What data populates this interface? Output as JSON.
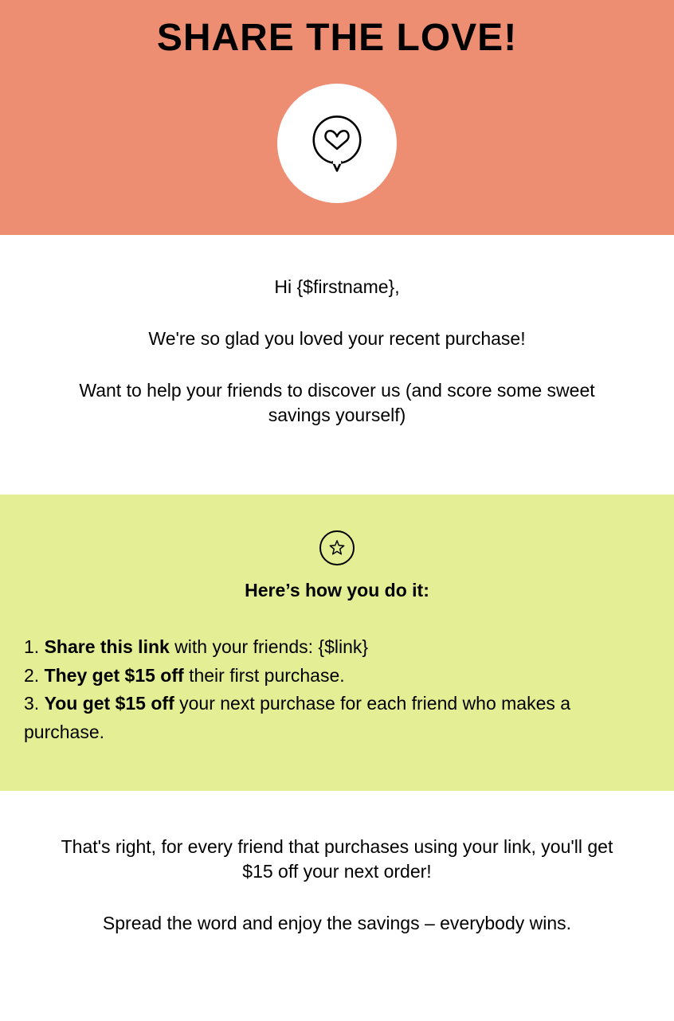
{
  "hero": {
    "title": "SHARE THE LOVE!"
  },
  "intro": {
    "greeting": "Hi {$firstname},",
    "line1": "We're so glad you loved your recent purchase!",
    "line2": "Want to help your friends to discover us (and score some sweet savings yourself)"
  },
  "howto": {
    "heading": "Here’s how you do it:",
    "step1_num": "1. ",
    "step1_bold": "Share this link",
    "step1_rest": " with your friends: {$link}",
    "step2_num": "2. ",
    "step2_bold": "They get $15 off",
    "step2_rest": " their first purchase.",
    "step3_num": "3. ",
    "step3_bold": "You get $15 off",
    "step3_rest": " your next purchase for each friend who makes a purchase."
  },
  "outro": {
    "line1": "That's right, for every friend that purchases using your link, you'll get $15 off your next order!",
    "line2": "Spread the word and enjoy the savings – everybody wins."
  }
}
